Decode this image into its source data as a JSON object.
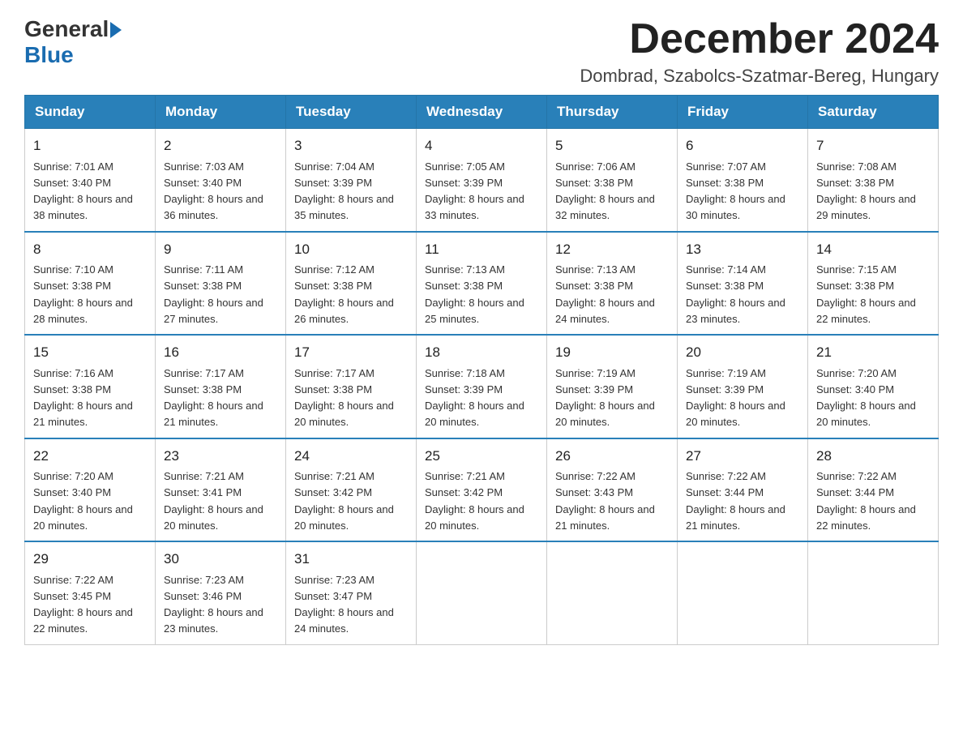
{
  "header": {
    "logo_general": "General",
    "logo_blue": "Blue",
    "month_title": "December 2024",
    "location": "Dombrad, Szabolcs-Szatmar-Bereg, Hungary"
  },
  "weekdays": [
    "Sunday",
    "Monday",
    "Tuesday",
    "Wednesday",
    "Thursday",
    "Friday",
    "Saturday"
  ],
  "weeks": [
    [
      {
        "day": "1",
        "sunrise": "7:01 AM",
        "sunset": "3:40 PM",
        "daylight": "8 hours and 38 minutes."
      },
      {
        "day": "2",
        "sunrise": "7:03 AM",
        "sunset": "3:40 PM",
        "daylight": "8 hours and 36 minutes."
      },
      {
        "day": "3",
        "sunrise": "7:04 AM",
        "sunset": "3:39 PM",
        "daylight": "8 hours and 35 minutes."
      },
      {
        "day": "4",
        "sunrise": "7:05 AM",
        "sunset": "3:39 PM",
        "daylight": "8 hours and 33 minutes."
      },
      {
        "day": "5",
        "sunrise": "7:06 AM",
        "sunset": "3:38 PM",
        "daylight": "8 hours and 32 minutes."
      },
      {
        "day": "6",
        "sunrise": "7:07 AM",
        "sunset": "3:38 PM",
        "daylight": "8 hours and 30 minutes."
      },
      {
        "day": "7",
        "sunrise": "7:08 AM",
        "sunset": "3:38 PM",
        "daylight": "8 hours and 29 minutes."
      }
    ],
    [
      {
        "day": "8",
        "sunrise": "7:10 AM",
        "sunset": "3:38 PM",
        "daylight": "8 hours and 28 minutes."
      },
      {
        "day": "9",
        "sunrise": "7:11 AM",
        "sunset": "3:38 PM",
        "daylight": "8 hours and 27 minutes."
      },
      {
        "day": "10",
        "sunrise": "7:12 AM",
        "sunset": "3:38 PM",
        "daylight": "8 hours and 26 minutes."
      },
      {
        "day": "11",
        "sunrise": "7:13 AM",
        "sunset": "3:38 PM",
        "daylight": "8 hours and 25 minutes."
      },
      {
        "day": "12",
        "sunrise": "7:13 AM",
        "sunset": "3:38 PM",
        "daylight": "8 hours and 24 minutes."
      },
      {
        "day": "13",
        "sunrise": "7:14 AM",
        "sunset": "3:38 PM",
        "daylight": "8 hours and 23 minutes."
      },
      {
        "day": "14",
        "sunrise": "7:15 AM",
        "sunset": "3:38 PM",
        "daylight": "8 hours and 22 minutes."
      }
    ],
    [
      {
        "day": "15",
        "sunrise": "7:16 AM",
        "sunset": "3:38 PM",
        "daylight": "8 hours and 21 minutes."
      },
      {
        "day": "16",
        "sunrise": "7:17 AM",
        "sunset": "3:38 PM",
        "daylight": "8 hours and 21 minutes."
      },
      {
        "day": "17",
        "sunrise": "7:17 AM",
        "sunset": "3:38 PM",
        "daylight": "8 hours and 20 minutes."
      },
      {
        "day": "18",
        "sunrise": "7:18 AM",
        "sunset": "3:39 PM",
        "daylight": "8 hours and 20 minutes."
      },
      {
        "day": "19",
        "sunrise": "7:19 AM",
        "sunset": "3:39 PM",
        "daylight": "8 hours and 20 minutes."
      },
      {
        "day": "20",
        "sunrise": "7:19 AM",
        "sunset": "3:39 PM",
        "daylight": "8 hours and 20 minutes."
      },
      {
        "day": "21",
        "sunrise": "7:20 AM",
        "sunset": "3:40 PM",
        "daylight": "8 hours and 20 minutes."
      }
    ],
    [
      {
        "day": "22",
        "sunrise": "7:20 AM",
        "sunset": "3:40 PM",
        "daylight": "8 hours and 20 minutes."
      },
      {
        "day": "23",
        "sunrise": "7:21 AM",
        "sunset": "3:41 PM",
        "daylight": "8 hours and 20 minutes."
      },
      {
        "day": "24",
        "sunrise": "7:21 AM",
        "sunset": "3:42 PM",
        "daylight": "8 hours and 20 minutes."
      },
      {
        "day": "25",
        "sunrise": "7:21 AM",
        "sunset": "3:42 PM",
        "daylight": "8 hours and 20 minutes."
      },
      {
        "day": "26",
        "sunrise": "7:22 AM",
        "sunset": "3:43 PM",
        "daylight": "8 hours and 21 minutes."
      },
      {
        "day": "27",
        "sunrise": "7:22 AM",
        "sunset": "3:44 PM",
        "daylight": "8 hours and 21 minutes."
      },
      {
        "day": "28",
        "sunrise": "7:22 AM",
        "sunset": "3:44 PM",
        "daylight": "8 hours and 22 minutes."
      }
    ],
    [
      {
        "day": "29",
        "sunrise": "7:22 AM",
        "sunset": "3:45 PM",
        "daylight": "8 hours and 22 minutes."
      },
      {
        "day": "30",
        "sunrise": "7:23 AM",
        "sunset": "3:46 PM",
        "daylight": "8 hours and 23 minutes."
      },
      {
        "day": "31",
        "sunrise": "7:23 AM",
        "sunset": "3:47 PM",
        "daylight": "8 hours and 24 minutes."
      },
      null,
      null,
      null,
      null
    ]
  ],
  "labels": {
    "sunrise_prefix": "Sunrise: ",
    "sunset_prefix": "Sunset: ",
    "daylight_prefix": "Daylight: "
  }
}
